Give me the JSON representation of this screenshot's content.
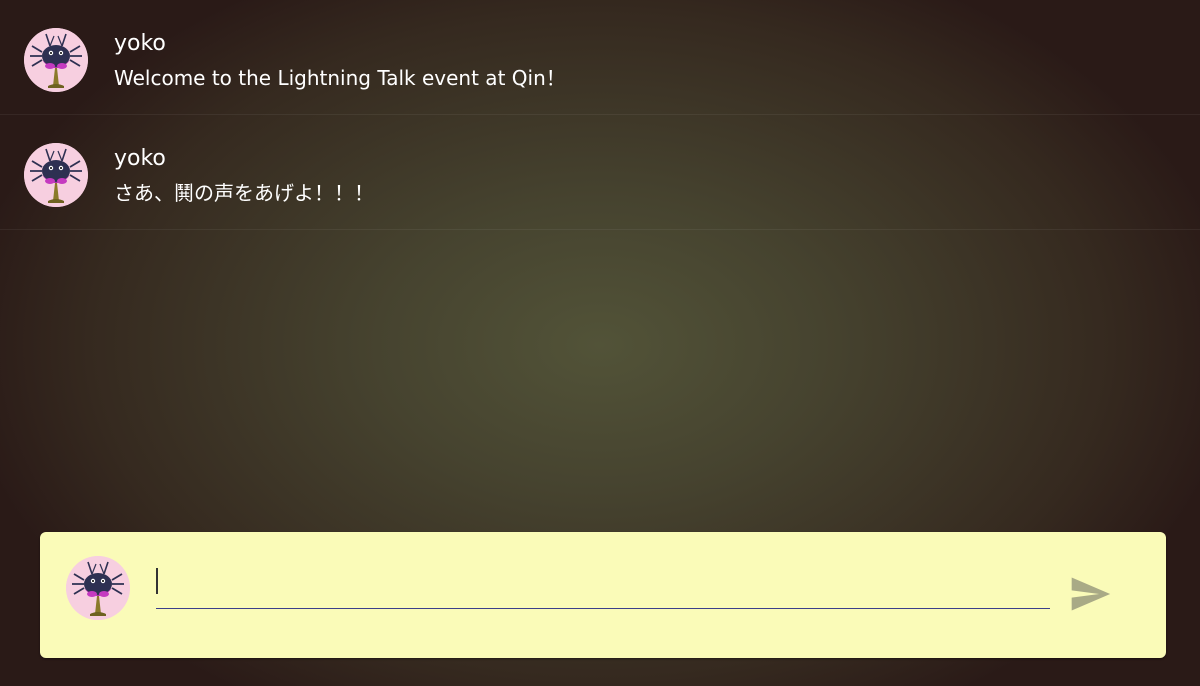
{
  "messages": [
    {
      "username": "yoko",
      "text": "Welcome to the Lightning Talk event at Qin！",
      "avatar": "bug-avatar-icon"
    },
    {
      "username": "yoko",
      "text": "さあ、鬨の声をあげよ！！！",
      "avatar": "bug-avatar-icon"
    }
  ],
  "composer": {
    "value": "",
    "placeholder": "",
    "send_icon": "send-icon",
    "avatar": "bug-avatar-icon"
  },
  "colors": {
    "background_center": "#525338",
    "background_edge": "#2a1a17",
    "composer_bg": "#fafbb8",
    "avatar_bg": "#f7cfe0",
    "input_underline": "#3b3f8a",
    "send_icon": "#a9aa86"
  }
}
